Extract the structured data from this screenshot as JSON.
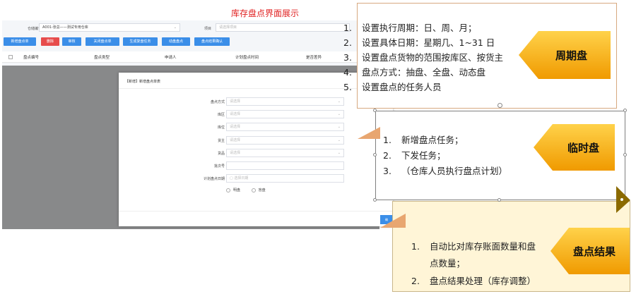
{
  "page_title": "库存盘点界面展示",
  "screenshot": {
    "filters": [
      {
        "label": "仓储编号",
        "value": "A001-张总——测试专用仓库",
        "placeholder": ""
      },
      {
        "label": "项目",
        "value": "",
        "placeholder": "请选择项目"
      }
    ],
    "toolbar": [
      "新增盘点单",
      "删除",
      "审核",
      "关闭盘点单",
      "生成复盘任务",
      "动盘盘点",
      "盘点结果确认"
    ],
    "columns": [
      "盘点编号",
      "盘点类型",
      "申请人",
      "计划盘点时间",
      "是否差异"
    ],
    "modal": {
      "title": "【新增】新增盘点单表",
      "fields": [
        {
          "label": "盘点方式",
          "placeholder": "请选择"
        },
        {
          "label": "库区",
          "placeholder": "请选择"
        },
        {
          "label": "库位",
          "placeholder": "请选择"
        },
        {
          "label": "货主",
          "placeholder": "请选择"
        },
        {
          "label": "货品",
          "placeholder": "请选择"
        },
        {
          "label": "批次号",
          "placeholder": ""
        },
        {
          "label": "计划盘点日期",
          "placeholder": "选择日期"
        }
      ],
      "radio_options": [
        "明盘",
        "盲盘"
      ],
      "confirm_label": "确"
    }
  },
  "callouts": [
    {
      "tag": "周期盘",
      "items": [
        {
          "num": "1.",
          "text": "设置执行周期：日、周、月；"
        },
        {
          "num": "2.",
          "text": "设置具体日期：星期几、1~31 日"
        },
        {
          "num": "3.",
          "text": "设置盘点货物的范围按库区、按货主"
        },
        {
          "num": "4.",
          "text": "盘点方式：抽盘、全盘、动态盘"
        },
        {
          "num": "5.",
          "text": "设置盘点的任务人员"
        }
      ]
    },
    {
      "tag": "临时盘",
      "items": [
        {
          "num": "1.",
          "text": "新增盘点任务；"
        },
        {
          "num": "2.",
          "text": "下发任务；"
        },
        {
          "num": "3.",
          "text": "（仓库人员执行盘点计划）"
        }
      ]
    },
    {
      "tag": "盘点结果",
      "items": [
        {
          "num": "1.",
          "text": "自动比对库存账面数量和盘"
        },
        {
          "num": "",
          "text": "点数量；"
        },
        {
          "num": "2.",
          "text": "盘点结果处理（库存调整）"
        }
      ]
    }
  ],
  "colors": {
    "title_red": "#e02020",
    "button_blue": "#3b8ee8",
    "button_red": "#e74c4c",
    "tag_orange": "#f5a300",
    "result_bg": "#fff5d7"
  }
}
